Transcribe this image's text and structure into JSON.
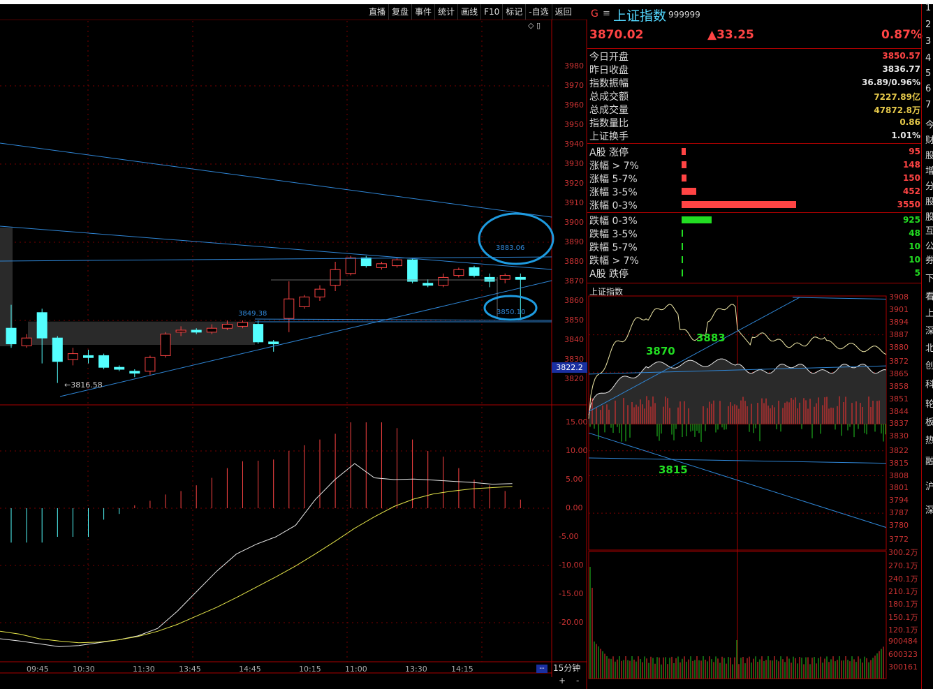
{
  "toolbar": [
    "直播",
    "复盘",
    "事件",
    "统计",
    "画线",
    "F10",
    "标记",
    "-自选",
    "返回"
  ],
  "quote": {
    "g_mark": "G",
    "menu_glyph": "≡",
    "name": "上证指数",
    "code": "999999",
    "price": "3870.02",
    "change": "▲33.25",
    "pct": "0.87%"
  },
  "stats": [
    {
      "label": "今日开盘",
      "value": "3850.57",
      "color": "#ff4444"
    },
    {
      "label": "昨日收盘",
      "value": "3836.77",
      "color": "#e8e8e8"
    },
    {
      "label": "指数振幅",
      "value": "36.89/0.96%",
      "color": "#e8e8e8"
    },
    {
      "label": "总成交额",
      "value": "7227.89亿",
      "color": "#e6c94a"
    },
    {
      "label": "总成交量",
      "value": "47872.8万",
      "color": "#e6c94a"
    },
    {
      "label": "指数量比",
      "value": "0.86",
      "color": "#e6c94a"
    },
    {
      "label": "上证换手",
      "value": "1.01%",
      "color": "#e8e8e8"
    }
  ],
  "breadth_up": [
    {
      "label": "A股 涨停",
      "value": "95",
      "bar": 0.036
    },
    {
      "label": "涨幅 > 7%",
      "value": "148",
      "bar": 0.042
    },
    {
      "label": "涨幅 5-7%",
      "value": "150",
      "bar": 0.043
    },
    {
      "label": "涨幅 3-5%",
      "value": "452",
      "bar": 0.129
    },
    {
      "label": "涨幅 0-3%",
      "value": "3550",
      "bar": 1.0
    }
  ],
  "breadth_down": [
    {
      "label": "跌幅 0-3%",
      "value": "925",
      "bar": 0.26
    },
    {
      "label": "跌幅 3-5%",
      "value": "48",
      "bar": 0.014
    },
    {
      "label": "跌幅 5-7%",
      "value": "10",
      "bar": 0.005
    },
    {
      "label": "跌幅 > 7%",
      "value": "10",
      "bar": 0.005
    },
    {
      "label": "A股 跌停",
      "value": "5",
      "bar": 0.005
    }
  ],
  "main_axis": [
    "3980",
    "3970",
    "3960",
    "3950",
    "3940",
    "3930",
    "3920",
    "3910",
    "3900",
    "3890",
    "3880",
    "3870",
    "3860",
    "3850",
    "3840",
    "3830",
    "3820"
  ],
  "main_marker": "3822.2",
  "macd_axis": [
    "15.00",
    "10.00",
    "5.00",
    "0.00",
    "-5.00",
    "-10.00",
    "-15.00",
    "-20.00"
  ],
  "time_labels": [
    "09:45",
    "10:30",
    "11:30",
    "13:45",
    "14:45",
    "10:15",
    "11:00",
    "13:30",
    "14:15"
  ],
  "period": "15分钟",
  "zoom_in": "+",
  "zoom_out": "-",
  "nav_mark": "--",
  "draw_tools_icons": "◇ ▯",
  "annotations": {
    "low": "3816.58",
    "a1": "3849.38",
    "circle_top": "3883.06",
    "circle_bottom": "3850.10"
  },
  "mini": {
    "title": "上证指数",
    "axis": [
      "3908",
      "3901",
      "3894",
      "3887",
      "3880",
      "3872",
      "3865",
      "3858",
      "3851",
      "3844",
      "3837",
      "3830",
      "3822",
      "3815",
      "3808",
      "3801",
      "3794",
      "3787",
      "3780",
      "3772"
    ],
    "vol_axis": [
      "300.2万",
      "270.1万",
      "240.1万",
      "210.1万",
      "180.1万",
      "150.1万",
      "120.1万",
      "900484",
      "600323",
      "300161"
    ],
    "notes": [
      "3883",
      "3870",
      "3815"
    ]
  },
  "edge_chars": [
    "1",
    "2",
    "3",
    "4",
    "5",
    "6",
    "7",
    "今",
    "财",
    "股",
    "增",
    "分",
    "股",
    "股",
    "互",
    "公",
    "券",
    "下",
    "看",
    "上",
    "深",
    "北",
    "创",
    "科",
    "轮",
    "板",
    "热",
    "融",
    "沪",
    "深"
  ],
  "colors": {
    "up": "#ff4444",
    "down": "#54ffff",
    "grid": "#7a0000",
    "line_blue": "#2f86d6",
    "white_line": "#e8e8e8",
    "yellow_line": "#e6e64a"
  },
  "chart_data": {
    "type": "candlestick",
    "title": "上证指数 15分钟",
    "ylim": [
      3810,
      3985
    ],
    "candles": [
      {
        "o": 3846,
        "c": 3838,
        "h": 3858,
        "l": 3836
      },
      {
        "o": 3837,
        "c": 3841,
        "h": 3843,
        "l": 3836
      },
      {
        "o": 3854,
        "c": 3841,
        "h": 3856,
        "l": 3828
      },
      {
        "o": 3841,
        "c": 3829,
        "h": 3842,
        "l": 3818
      },
      {
        "o": 3830,
        "c": 3833,
        "h": 3836,
        "l": 3827
      },
      {
        "o": 3832,
        "c": 3831,
        "h": 3835,
        "l": 3828
      },
      {
        "o": 3832,
        "c": 3826,
        "h": 3833,
        "l": 3825
      },
      {
        "o": 3826,
        "c": 3825,
        "h": 3827,
        "l": 3824
      },
      {
        "o": 3824,
        "c": 3823,
        "h": 3825,
        "l": 3821
      },
      {
        "o": 3824,
        "c": 3831,
        "h": 3832,
        "l": 3822
      },
      {
        "o": 3832,
        "c": 3843,
        "h": 3844,
        "l": 3831
      },
      {
        "o": 3844,
        "c": 3845,
        "h": 3847,
        "l": 3842
      },
      {
        "o": 3845,
        "c": 3844,
        "h": 3846,
        "l": 3843
      },
      {
        "o": 3844,
        "c": 3846,
        "h": 3848,
        "l": 3843
      },
      {
        "o": 3846,
        "c": 3848,
        "h": 3850,
        "l": 3845
      },
      {
        "o": 3847,
        "c": 3849,
        "h": 3850,
        "l": 3846
      },
      {
        "o": 3848,
        "c": 3839,
        "h": 3850,
        "l": 3838
      },
      {
        "o": 3839,
        "c": 3838,
        "h": 3840,
        "l": 3834
      },
      {
        "o": 3851,
        "c": 3861,
        "h": 3870,
        "l": 3844
      },
      {
        "o": 3857,
        "c": 3862,
        "h": 3863,
        "l": 3856
      },
      {
        "o": 3862,
        "c": 3866,
        "h": 3868,
        "l": 3860
      },
      {
        "o": 3868,
        "c": 3876,
        "h": 3880,
        "l": 3865
      },
      {
        "o": 3874,
        "c": 3882,
        "h": 3883,
        "l": 3873
      },
      {
        "o": 3882,
        "c": 3878,
        "h": 3883,
        "l": 3877
      },
      {
        "o": 3877,
        "c": 3879,
        "h": 3880,
        "l": 3876
      },
      {
        "o": 3878,
        "c": 3881,
        "h": 3882,
        "l": 3877
      },
      {
        "o": 3881,
        "c": 3870,
        "h": 3882,
        "l": 3869
      },
      {
        "o": 3869,
        "c": 3868,
        "h": 3871,
        "l": 3867
      },
      {
        "o": 3868,
        "c": 3872,
        "h": 3874,
        "l": 3867
      },
      {
        "o": 3873,
        "c": 3876,
        "h": 3877,
        "l": 3872
      },
      {
        "o": 3877,
        "c": 3873,
        "h": 3878,
        "l": 3872
      },
      {
        "o": 3872,
        "c": 3870,
        "h": 3874,
        "l": 3867
      },
      {
        "o": 3871,
        "c": 3873,
        "h": 3874,
        "l": 3869
      },
      {
        "o": 3872,
        "c": 3871,
        "h": 3874,
        "l": 3850
      }
    ],
    "macd_hist": [
      -6,
      -6,
      -6,
      -5,
      -5,
      -5,
      -2,
      -1,
      0.5,
      1.3,
      2.4,
      3,
      4,
      5.3,
      7,
      8.2,
      8.3,
      8.5,
      10,
      11,
      12,
      13,
      15,
      15,
      15,
      14,
      12,
      10,
      9,
      7,
      5,
      4,
      3,
      1.5
    ],
    "dif": [
      -22.8,
      -23.2,
      -23.7,
      -24.2,
      -24.0,
      -23.5,
      -23.0,
      -22.3,
      -21.0,
      -18.0,
      -14.5,
      -11.0,
      -8.0,
      -6.3,
      -5.0,
      -3.0,
      1.5,
      5.0,
      7.8,
      5.3,
      5.0,
      5.1,
      4.9,
      4.7,
      4.5,
      4.2,
      4.3
    ],
    "dea": [
      -21.5,
      -22.0,
      -22.8,
      -23.2,
      -23.5,
      -23.4,
      -23.0,
      -22.4,
      -21.5,
      -20.3,
      -18.8,
      -17.3,
      -15.6,
      -13.8,
      -12.0,
      -10.1,
      -8.0,
      -5.8,
      -3.5,
      -1.5,
      0.3,
      1.6,
      2.5,
      3.0,
      3.4,
      3.6,
      3.8
    ]
  }
}
